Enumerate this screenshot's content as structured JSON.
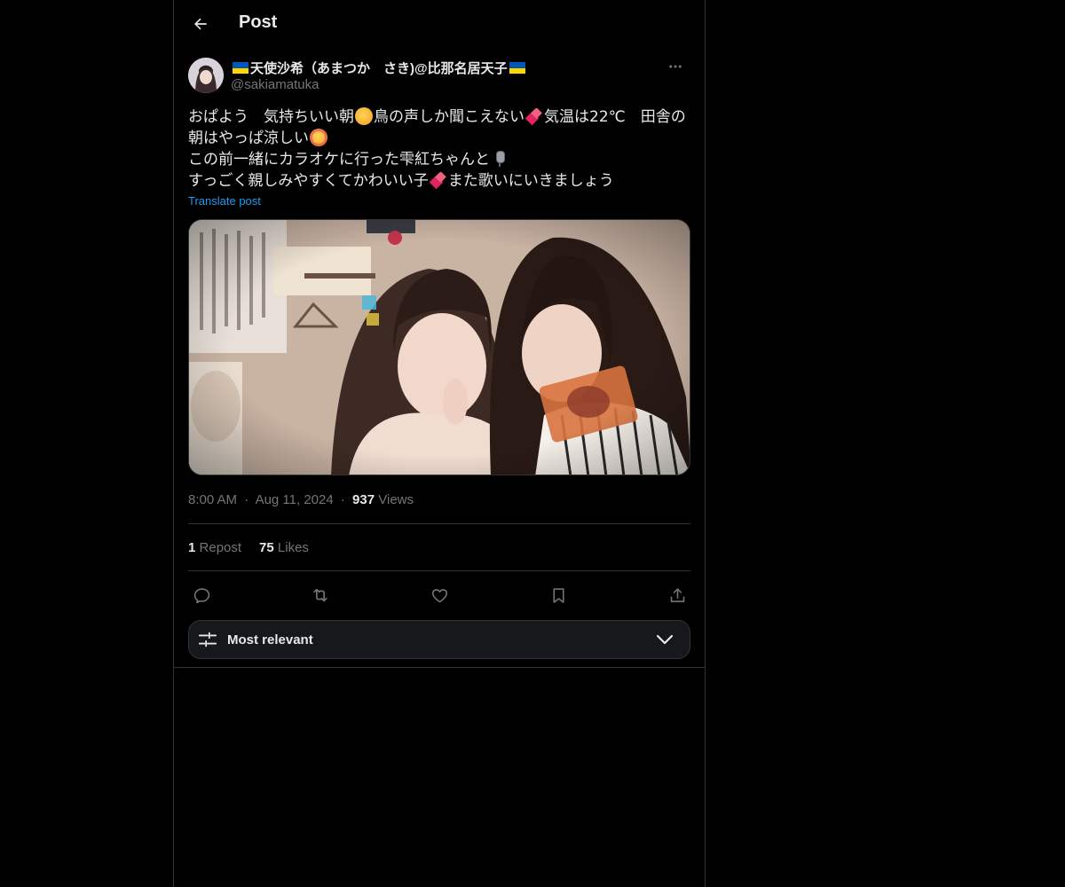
{
  "header": {
    "title": "Post"
  },
  "author": {
    "display_name": "天使沙希（あまつか　さき)@比那名居天子",
    "handle": "@sakiamatuka",
    "flag_colors": {
      "top": "#0057b7",
      "bottom": "#ffd700"
    }
  },
  "post": {
    "line1_a": "おぱよう　気持ちいい朝",
    "line1_b": "鳥の声しか聞こえない",
    "line1_c": "気温は22℃　田舎の",
    "line2_a": "朝はやっぱ涼しい",
    "line3_a": "この前一緒にカラオケに行った雫紅ちゃんと",
    "line4_a": "すっごく親しみやすくてかわいい子",
    "line4_b": "また歌いにいきましょう",
    "translate_label": "Translate post"
  },
  "meta": {
    "time": "8:00 AM",
    "date": "Aug 11, 2024",
    "views_count": "937",
    "views_label": "Views",
    "separator": "·"
  },
  "stats": {
    "reposts_count": "1",
    "reposts_label": "Repost",
    "likes_count": "75",
    "likes_label": "Likes"
  },
  "sort": {
    "label": "Most relevant"
  },
  "colors": {
    "background": "#000000",
    "text": "#e7e9ea",
    "muted": "#71767b",
    "accent": "#1d9bf0",
    "border": "#2f3336"
  },
  "icons": {
    "back": "arrow-left-icon",
    "more": "more-horizontal-icon",
    "reply": "reply-icon",
    "repost": "repost-icon",
    "like": "heart-icon",
    "bookmark": "bookmark-icon",
    "share": "share-icon",
    "filter": "sliders-icon",
    "chevron": "chevron-down-icon"
  }
}
